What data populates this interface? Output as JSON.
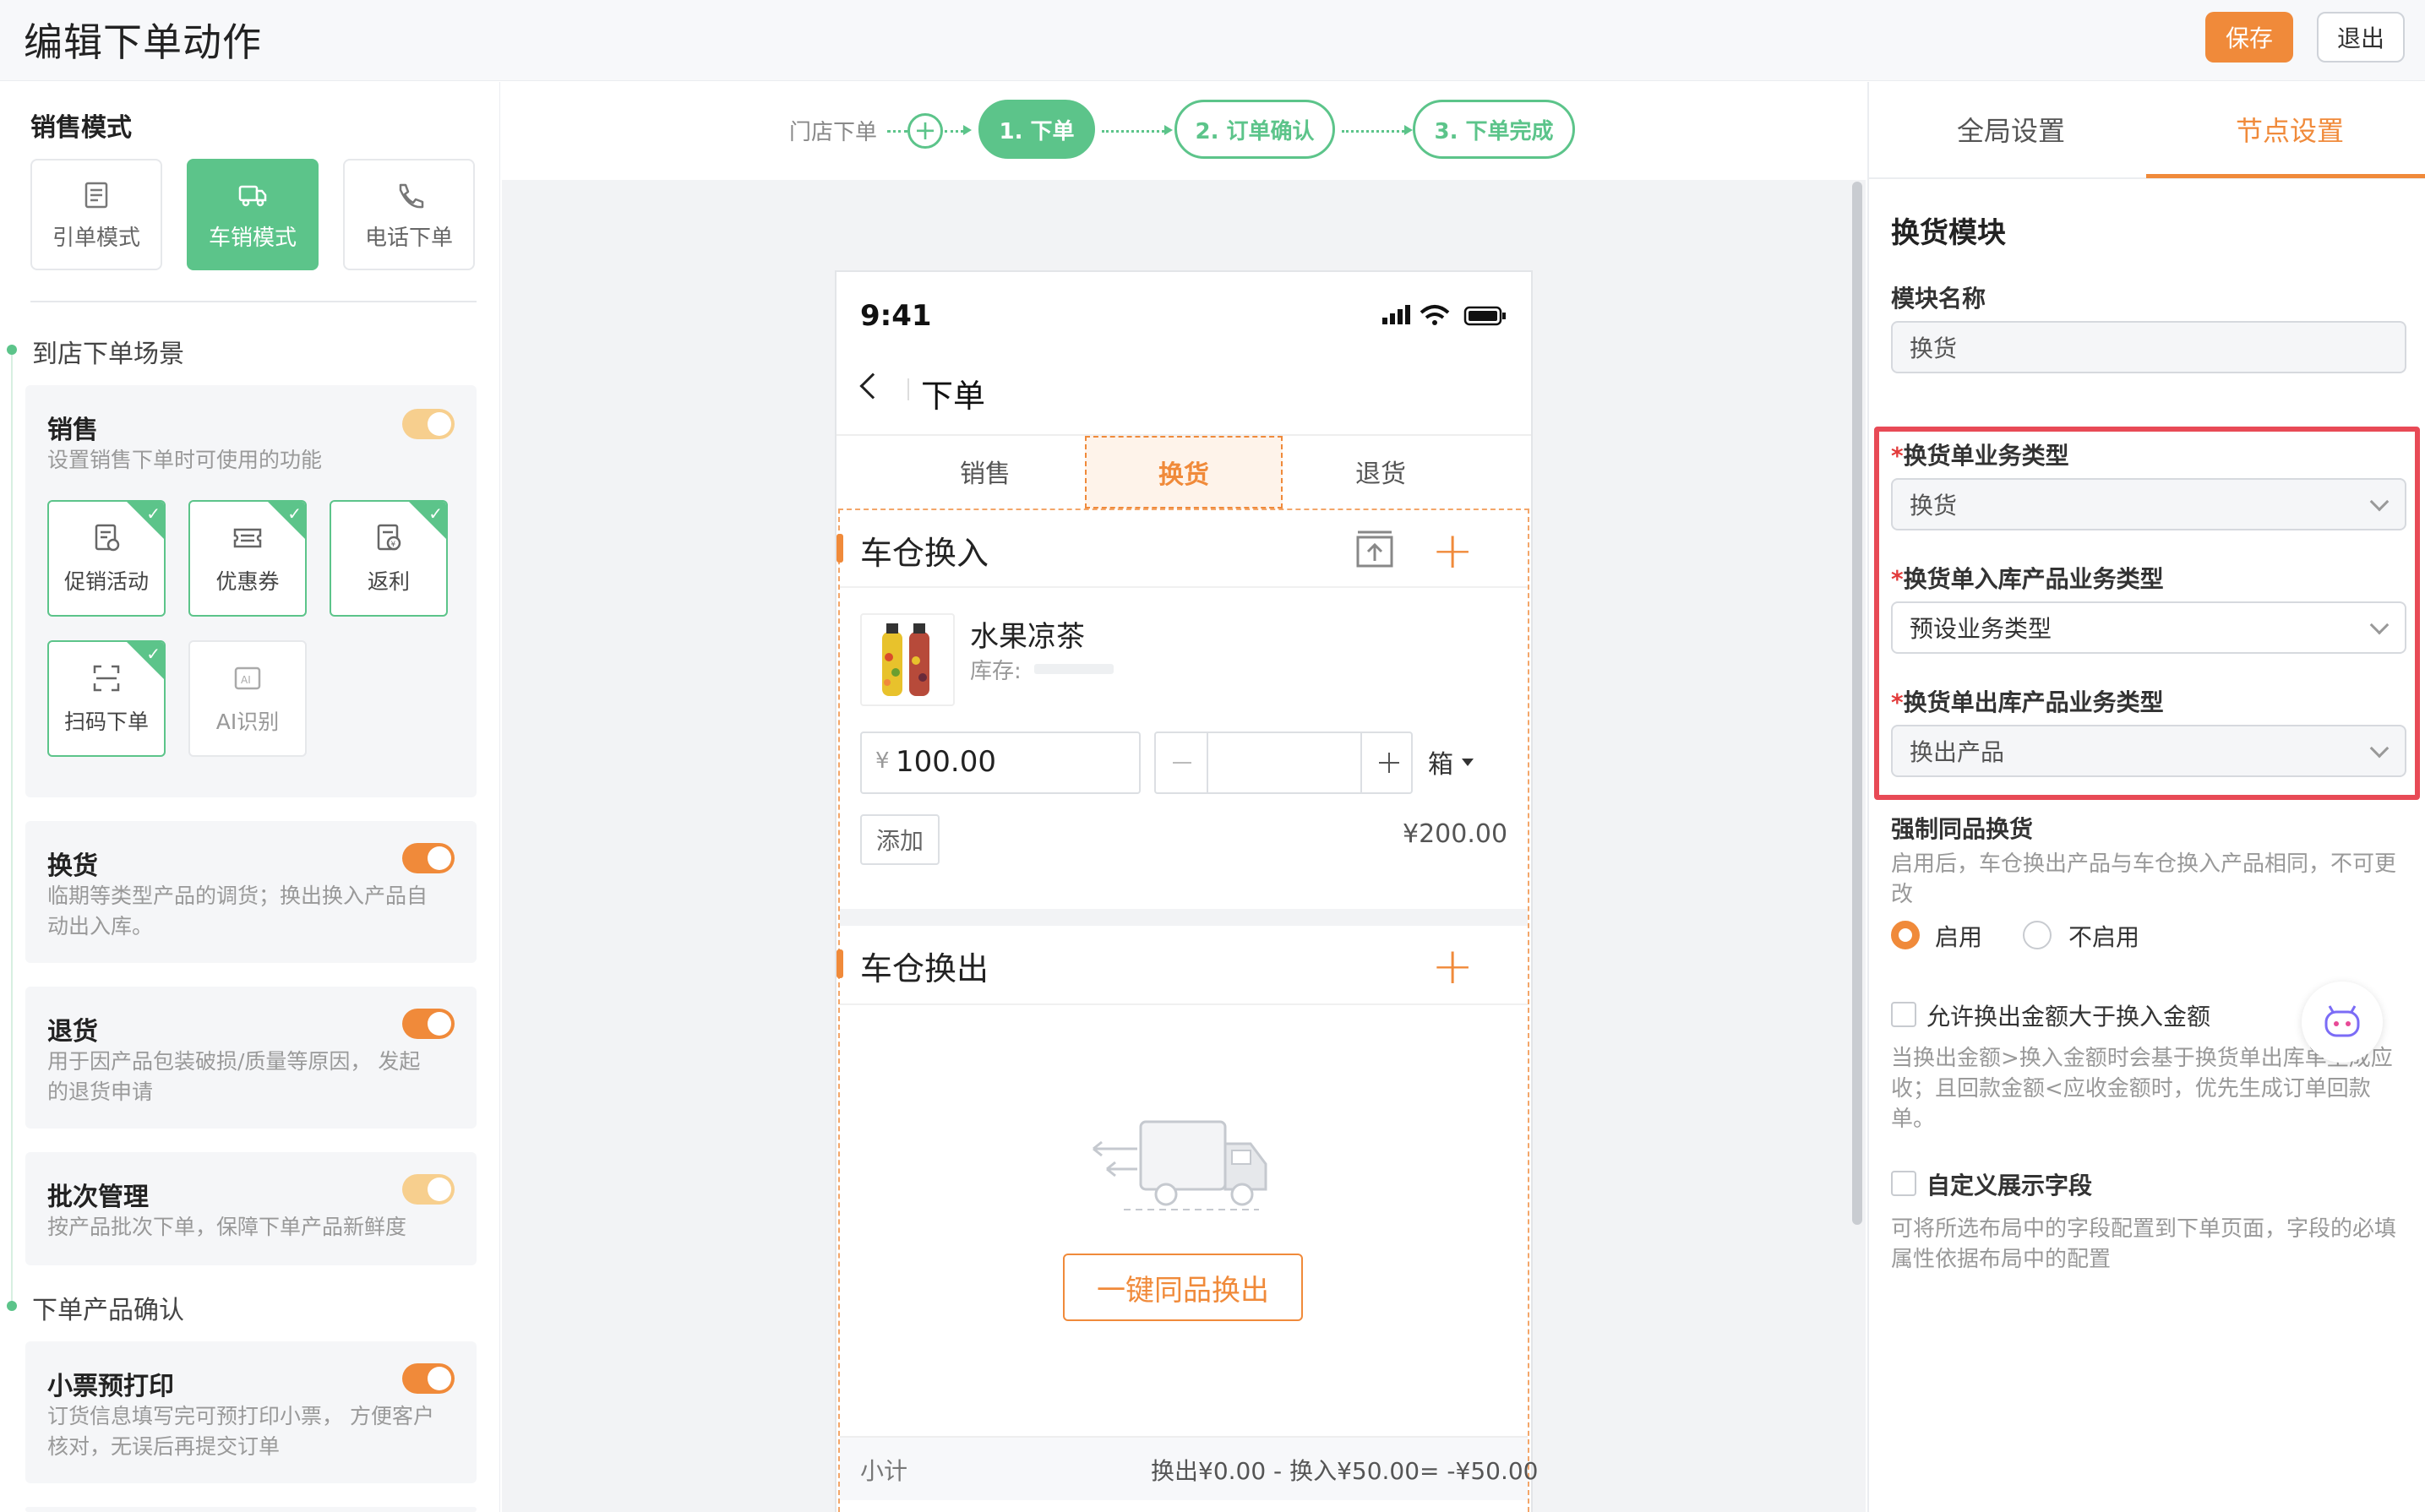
{
  "header": {
    "title": "编辑下单动作",
    "save_label": "保存",
    "exit_label": "退出"
  },
  "left": {
    "sales_mode_title": "销售模式",
    "modes": [
      {
        "label": "引单模式",
        "active": false
      },
      {
        "label": "车销模式",
        "active": true
      },
      {
        "label": "电话下单",
        "active": false
      }
    ],
    "scene_title": "到店下单场景",
    "sales_panel": {
      "title": "销售",
      "desc": "设置销售下单时可使用的功能",
      "features": [
        {
          "label": "促销活动",
          "checked": true
        },
        {
          "label": "优惠券",
          "checked": true
        },
        {
          "label": "返利",
          "checked": true
        },
        {
          "label": "扫码下单",
          "checked": true
        },
        {
          "label": "AI识别",
          "checked": false
        }
      ]
    },
    "exchange_panel": {
      "title": "换货",
      "desc_1": "临期等类型产品的调货；换出换入产品自",
      "desc_2": "动出入库。"
    },
    "return_panel": {
      "title": "退货",
      "desc_1": "用于因产品包装破损/质量等原因，  发起",
      "desc_2": "的退货申请"
    },
    "batch_panel": {
      "title": "批次管理",
      "desc_1": "按产品批次下单，保障下单产品新鲜度"
    },
    "confirm_title": "下单产品确认",
    "print_panel": {
      "title": "小票预打印",
      "desc_1": "订货信息填写完可预打印小票，  方便客户",
      "desc_2": "核对，无误后再提交订单"
    }
  },
  "steps": {
    "start_label": "门店下单",
    "step1": "1. 下单",
    "step2": "2. 订单确认",
    "step3": "3. 下单完成"
  },
  "phone": {
    "time": "9:41",
    "title": "下单",
    "tabs": [
      "销售",
      "换货",
      "退货"
    ],
    "section_in": "车仓换入",
    "product_name": "水果凉茶",
    "stock_label": "库存:",
    "currency": "¥",
    "price": "100.00",
    "unit": "箱",
    "add_label": "添加",
    "line_total": "¥200.00",
    "section_out": "车仓换出",
    "one_click_label": "一键同品换出",
    "subtotal_label": "小计",
    "subtotal_value": "换出¥0.00 - 换入¥50.00= -¥50.00"
  },
  "right": {
    "tab_global": "全局设置",
    "tab_node": "节点设置",
    "module_title": "换货模块",
    "module_name_label": "模块名称",
    "module_name_value": "换货",
    "biz_type_label": "换货单业务类型",
    "biz_type_value": "换货",
    "in_type_label": "换货单入库产品业务类型",
    "in_type_value": "预设业务类型",
    "out_type_label": "换货单出库产品业务类型",
    "out_type_value": "换出产品",
    "force_same_label": "强制同品换货",
    "force_same_desc_1": "启用后，车仓换出产品与车仓换入产品相同，不可更",
    "force_same_desc_2": "改",
    "radio_on": "启用",
    "radio_off": "不启用",
    "allow_amount_label": "允许换出金额大于换入金额",
    "allow_amount_desc_1": "当换出金额>换入金额时会基于换货单出库单生成应",
    "allow_amount_desc_2": "收；且回款金额<应收金额时，优先生成订单回款",
    "allow_amount_desc_3": "单。",
    "custom_fields_label": "自定义展示字段",
    "custom_fields_desc_1": "可将所选布局中的字段配置到下单页面，字段的必填",
    "custom_fields_desc_2": "属性依据布局中的配置"
  },
  "colors": {
    "accent": "#f08a3a",
    "green": "#5cc48a",
    "highlight": "#e84a56"
  }
}
